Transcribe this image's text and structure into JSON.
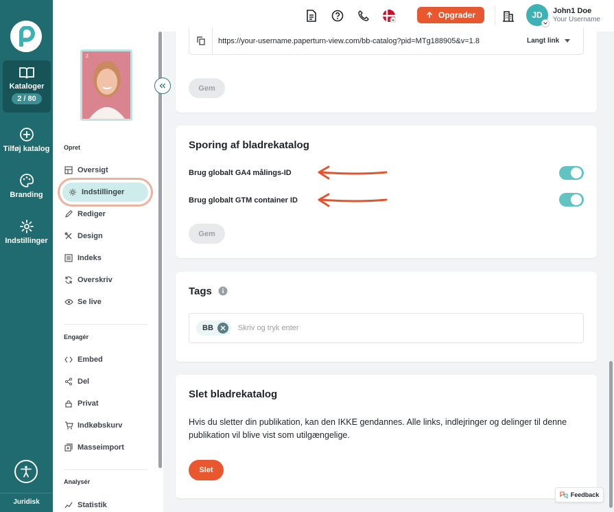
{
  "rail": {
    "catalogs_label": "Kataloger",
    "catalogs_count": "2 / 80",
    "add_label": "Tilføj katalog",
    "branding_label": "Branding",
    "settings_label": "Indstillinger",
    "legal_label": "Juridisk"
  },
  "header": {
    "upgrade_label": "Opgrader",
    "avatar_initials": "JD",
    "user_name": "John1 Doe",
    "user_sub": "Your Username"
  },
  "subnav": {
    "create_heading": "Opret",
    "create_items": [
      "Oversigt",
      "Indstillinger",
      "Rediger",
      "Design",
      "Indeks",
      "Overskriv",
      "Se live"
    ],
    "engage_heading": "Engagér",
    "engage_items": [
      "Embed",
      "Del",
      "Privat",
      "Indkøbskurv",
      "Masseimport"
    ],
    "analyze_heading": "Analysér",
    "analyze_items": [
      "Statistik"
    ],
    "thumb_caption": "Z"
  },
  "link_card": {
    "url": "https://your-username.paperturn-view.com/bb-catalog?pid=MTg188905&v=1.8",
    "link_type": "Langt link",
    "save_label": "Gem"
  },
  "tracking": {
    "title": "Sporing af bladrekatalog",
    "ga4_label": "Brug globalt GA4 målings-ID",
    "gtm_label": "Brug globalt GTM container ID",
    "save_label": "Gem"
  },
  "tags": {
    "title": "Tags",
    "chip": "BB",
    "placeholder": "Skriv og tryk enter"
  },
  "delete": {
    "title": "Slet bladrekatalog",
    "description": "Hvis du sletter din publikation, kan den IKKE gendannes. Alle links, indlejringer og delinger til denne publikation vil blive vist som utilgængelige.",
    "button_label": "Slet"
  },
  "feedback_label": "Feedback",
  "colors": {
    "teal": "#1f6b6f",
    "accent": "#e8572d",
    "toggle": "#62c3c3"
  }
}
